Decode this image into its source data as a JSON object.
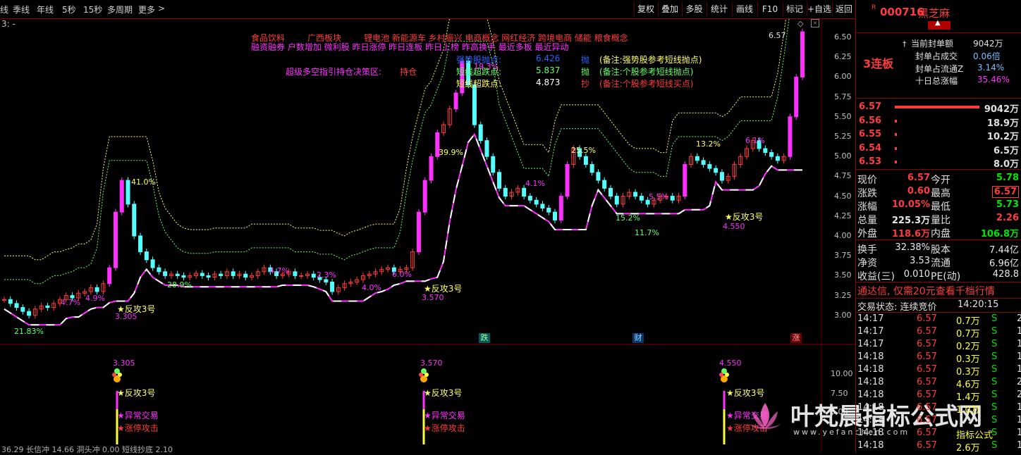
{
  "toolbar": {
    "period_tabs": [
      "线",
      "季线",
      "年线",
      "5秒",
      "15秒",
      "多周期",
      "更多"
    ],
    "more_arrow": ">",
    "buttons": [
      "复权",
      "叠加",
      "多股",
      "统计",
      "画线",
      "F10",
      "标记",
      "+自选",
      "返回"
    ]
  },
  "chart": {
    "indicator_label": "3: -",
    "price_axis": [
      "6.50",
      "6.25",
      "6.00",
      "5.75",
      "5.50",
      "5.25",
      "5.00",
      "4.75",
      "4.50",
      "4.25",
      "4.00",
      "3.75",
      "3.50",
      "3.25",
      "3.00"
    ],
    "lower_axis": [
      "10.00",
      "7.50",
      "5.00"
    ],
    "high_label": "6.57",
    "concepts_line1": [
      "食品饮料",
      "广西板块",
      "锂电池 新能源车 乡村振兴 电商概念 网红经济 跨境电商 储能 粮食概念"
    ],
    "concepts_line2": "融资融券 户数增加 微利股 昨日涨停 昨日连板 昨日上榜 昨高换手 最近多板 最近异动",
    "strategy_label": "超级多空指引持仓决策区:",
    "strategy_value": "持仓",
    "signals": [
      {
        "name": "强势股抛点:",
        "value": "6.426",
        "action": "抛",
        "note": "(备注:强势股参考短线抛点)"
      },
      {
        "name": "短线超跌点:",
        "value": "5.837",
        "action": "抛",
        "note": "(备注:个股参考短线抛点)"
      },
      {
        "name": "短线超跌点:",
        "value": "4.873",
        "action": "抄",
        "note": "(备注:个股参考短线买点)"
      }
    ],
    "pct_labels": [
      "41.0%",
      "4.7%",
      "4.9%",
      "28.9%",
      "4.7%",
      "2.3%",
      "4.0%",
      "6.0%",
      "39.9%",
      "19.3%",
      "4.1%",
      "25.5%",
      "5.5%",
      "15.2%",
      "11.7%",
      "13.2%",
      "6.1%",
      "21.83%"
    ],
    "low_labels": [
      "3.305",
      "3.570",
      "4.550"
    ],
    "attack_label": "★反攻3号",
    "bottom_badges": [
      "跌",
      "财",
      "涨"
    ],
    "lower_signals": [
      {
        "price": "3.305",
        "a": "★反攻3号",
        "b": "★异常交易",
        "c": "★涨停攻击"
      },
      {
        "price": "3.570",
        "a": "★反攻3号",
        "b": "★异常交易",
        "c": "★涨停攻击"
      },
      {
        "price": "4.550",
        "a": "★反攻3号",
        "b": "★异常交易",
        "c": "★涨停攻击"
      }
    ],
    "bottom_text": "36.29 长信冲 14.66 洞头冲 0.00 短线抄底 2.10",
    "watermark": "叶梵晨指标公式网",
    "watermark_url": "www.yefanchen.com"
  },
  "quote": {
    "r_mark": "R",
    "code": "000716",
    "name": "黑芝麻",
    "board_tag": "3连板",
    "stats": [
      {
        "label": "当前封单额",
        "value": "9042万"
      },
      {
        "label": "封单占成交",
        "value": "0.06倍"
      },
      {
        "label": "封单占流通Z",
        "value": "3.14%"
      },
      {
        "label": "十日总涨幅",
        "value": "35.46%"
      }
    ],
    "bids": [
      {
        "price": "6.57",
        "vol": "9042万",
        "bar": 1.0
      },
      {
        "price": "6.56",
        "vol": "18.9万",
        "bar": 0.02
      },
      {
        "price": "6.55",
        "vol": "10.2万",
        "bar": 0.02
      },
      {
        "price": "6.54",
        "vol": "6.5万",
        "bar": 0.02
      },
      {
        "price": "6.53",
        "vol": "8.0万",
        "bar": 0.02
      }
    ],
    "fields": [
      {
        "l1": "现价",
        "v1": "6.57",
        "c1": "red",
        "l2": "今开",
        "v2": "5.78",
        "c2": "green"
      },
      {
        "l1": "涨跌",
        "v1": "0.60",
        "c1": "red",
        "l2": "最高",
        "v2": "6.57",
        "c2": "red"
      },
      {
        "l1": "涨幅",
        "v1": "10.05%",
        "c1": "red",
        "l2": "最低",
        "v2": "5.73",
        "c2": "green"
      },
      {
        "l1": "总量",
        "v1": "225.3万",
        "c1": "white",
        "l2": "量比",
        "v2": "2.26",
        "c2": "red"
      },
      {
        "l1": "外盘",
        "v1": "118.6万",
        "c1": "red",
        "l2": "内盘",
        "v2": "106.8万",
        "c2": "green"
      }
    ],
    "fields2": [
      {
        "l1": "换手",
        "v1": "32.38%",
        "l2": "股本",
        "v2": "7.44亿"
      },
      {
        "l1": "净资",
        "v1": "3.53",
        "l2": "流通",
        "v2": "6.96亿"
      },
      {
        "l1": "收益(三)",
        "v1": "0.010",
        "l2": "PE(动)",
        "v2": "428.8"
      }
    ],
    "promo": "通达信, 仅需20元查看千档行情",
    "trade_status_label": "交易状态: 连续竞价",
    "trade_time": "14:20:15",
    "ticks": [
      {
        "t": "14:17",
        "p": "6.57",
        "v": "0.7万",
        "s": "S",
        "n": "2"
      },
      {
        "t": "14:17",
        "p": "6.57",
        "v": "0.7万",
        "s": "S",
        "n": "1"
      },
      {
        "t": "14:17",
        "p": "6.57",
        "v": "0.2万",
        "s": "S",
        "n": "1"
      },
      {
        "t": "14:18",
        "p": "6.57",
        "v": "0.3万",
        "s": "S",
        "n": "1"
      },
      {
        "t": "14:18",
        "p": "6.57",
        "v": "0.3万",
        "s": "S",
        "n": "1"
      },
      {
        "t": "14:18",
        "p": "6.57",
        "v": "4.6万",
        "s": "S",
        "n": "2"
      },
      {
        "t": "14:18",
        "p": "6.57",
        "v": "1.4万",
        "s": "S",
        "n": "2"
      },
      {
        "t": "14:18",
        "p": "6.57",
        "v": "1.0万",
        "s": "S",
        "n": "1"
      },
      {
        "t": "14:18",
        "p": "6.57",
        "v": "",
        "s": "S",
        "n": "1"
      },
      {
        "t": "14:18",
        "p": "6.57",
        "v": "指标公式",
        "s": "S",
        "n": "1"
      },
      {
        "t": "14:18",
        "p": "6.57",
        "v": "2.6万",
        "s": "S",
        "n": "1"
      }
    ]
  },
  "colors": {
    "up": "#ff3c3c",
    "down": "#54ffff",
    "magenta": "#ff30ff",
    "yellow_line": "#ffff66",
    "green_line": "#66ff66"
  }
}
